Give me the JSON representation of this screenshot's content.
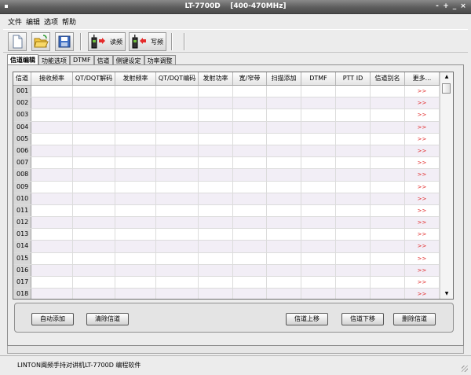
{
  "window": {
    "title": "LT-7700D    [400-470MHz]",
    "buttons": [
      "-",
      "+",
      "_",
      "×"
    ]
  },
  "menu": [
    "文件",
    "编辑",
    "选项",
    "帮助"
  ],
  "toolbar": {
    "read_label": "读频",
    "write_label": "写频"
  },
  "tabs": [
    "信道编辑",
    "功能选项",
    "DTMF",
    "信道",
    "侧键设定",
    "功率调整"
  ],
  "table": {
    "columns": [
      "信道",
      "接收频率",
      "QT/DQT解码",
      "发射频率",
      "QT/DQT编码",
      "发射功率",
      "宽/窄带",
      "扫描添加",
      "DTMF",
      "PTT ID",
      "信道别名",
      "更多..."
    ],
    "rows": [
      "001",
      "002",
      "003",
      "004",
      "005",
      "006",
      "007",
      "008",
      "009",
      "010",
      "011",
      "012",
      "013",
      "014",
      "015",
      "016",
      "017",
      "018"
    ],
    "more_glyph": ">>"
  },
  "buttons": {
    "auto_add": "自动添加",
    "clear_channels": "清除信道",
    "move_up": "信道上移",
    "move_down": "信道下移",
    "delete_channel": "删除信道"
  },
  "status": {
    "text": "LINTON闽频手持对讲机LT-7700D 编程软件"
  },
  "colors": {
    "title_bar": "#5d5d5d",
    "row_alt": "#f2eef6",
    "more_link": "#e02020"
  }
}
